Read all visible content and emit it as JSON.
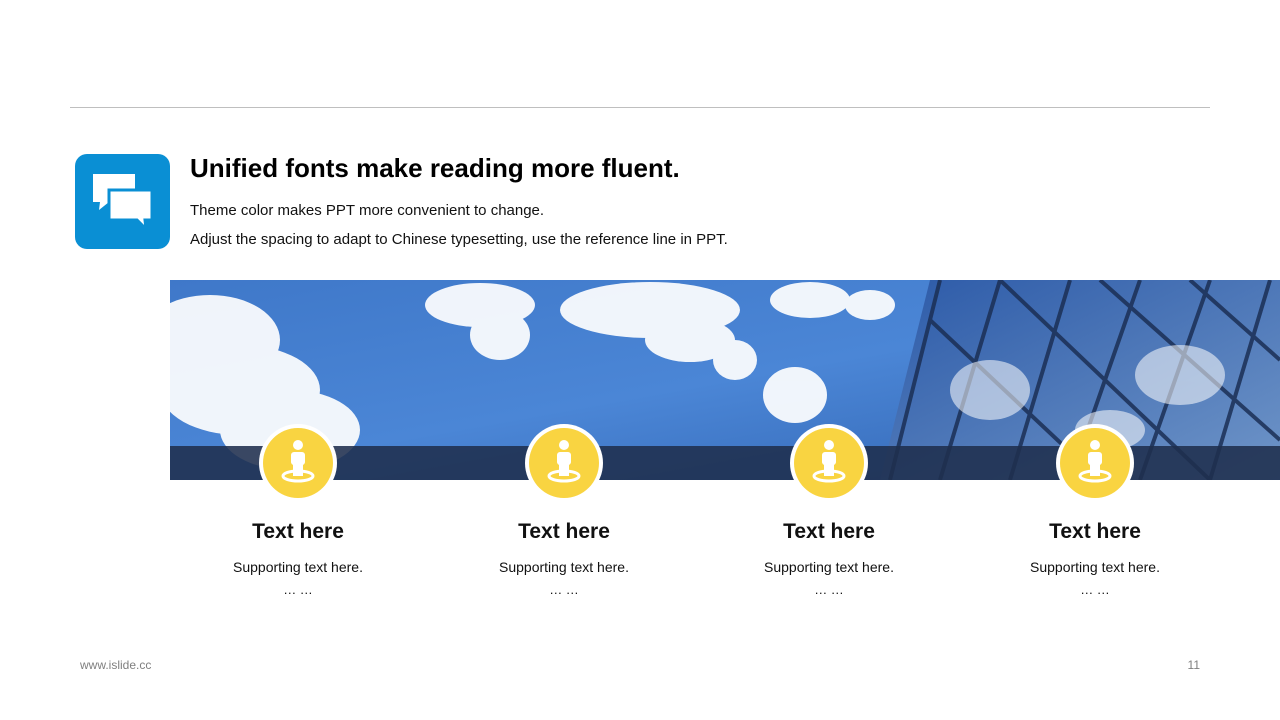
{
  "header": {
    "title": "Unified fonts make reading more fluent.",
    "line1": "Theme color makes PPT more convenient to change.",
    "line2": "Adjust the spacing to adapt to Chinese typesetting, use the reference line in PPT."
  },
  "icons": {
    "header_icon": "chat-bubbles-icon",
    "step_icon": "person-location-icon"
  },
  "colors": {
    "accent_blue": "#0a8fd4",
    "accent_yellow": "#f9d441",
    "band": "#1f2f4d"
  },
  "steps": [
    {
      "title": "Text here",
      "sub": "Supporting text here.",
      "dots": "… …"
    },
    {
      "title": "Text here",
      "sub": "Supporting text here.",
      "dots": "… …"
    },
    {
      "title": "Text here",
      "sub": "Supporting text here.",
      "dots": "… …"
    },
    {
      "title": "Text here",
      "sub": "Supporting text here.",
      "dots": "… …"
    }
  ],
  "footer": {
    "url": "www.islide.cc",
    "page": "11"
  }
}
